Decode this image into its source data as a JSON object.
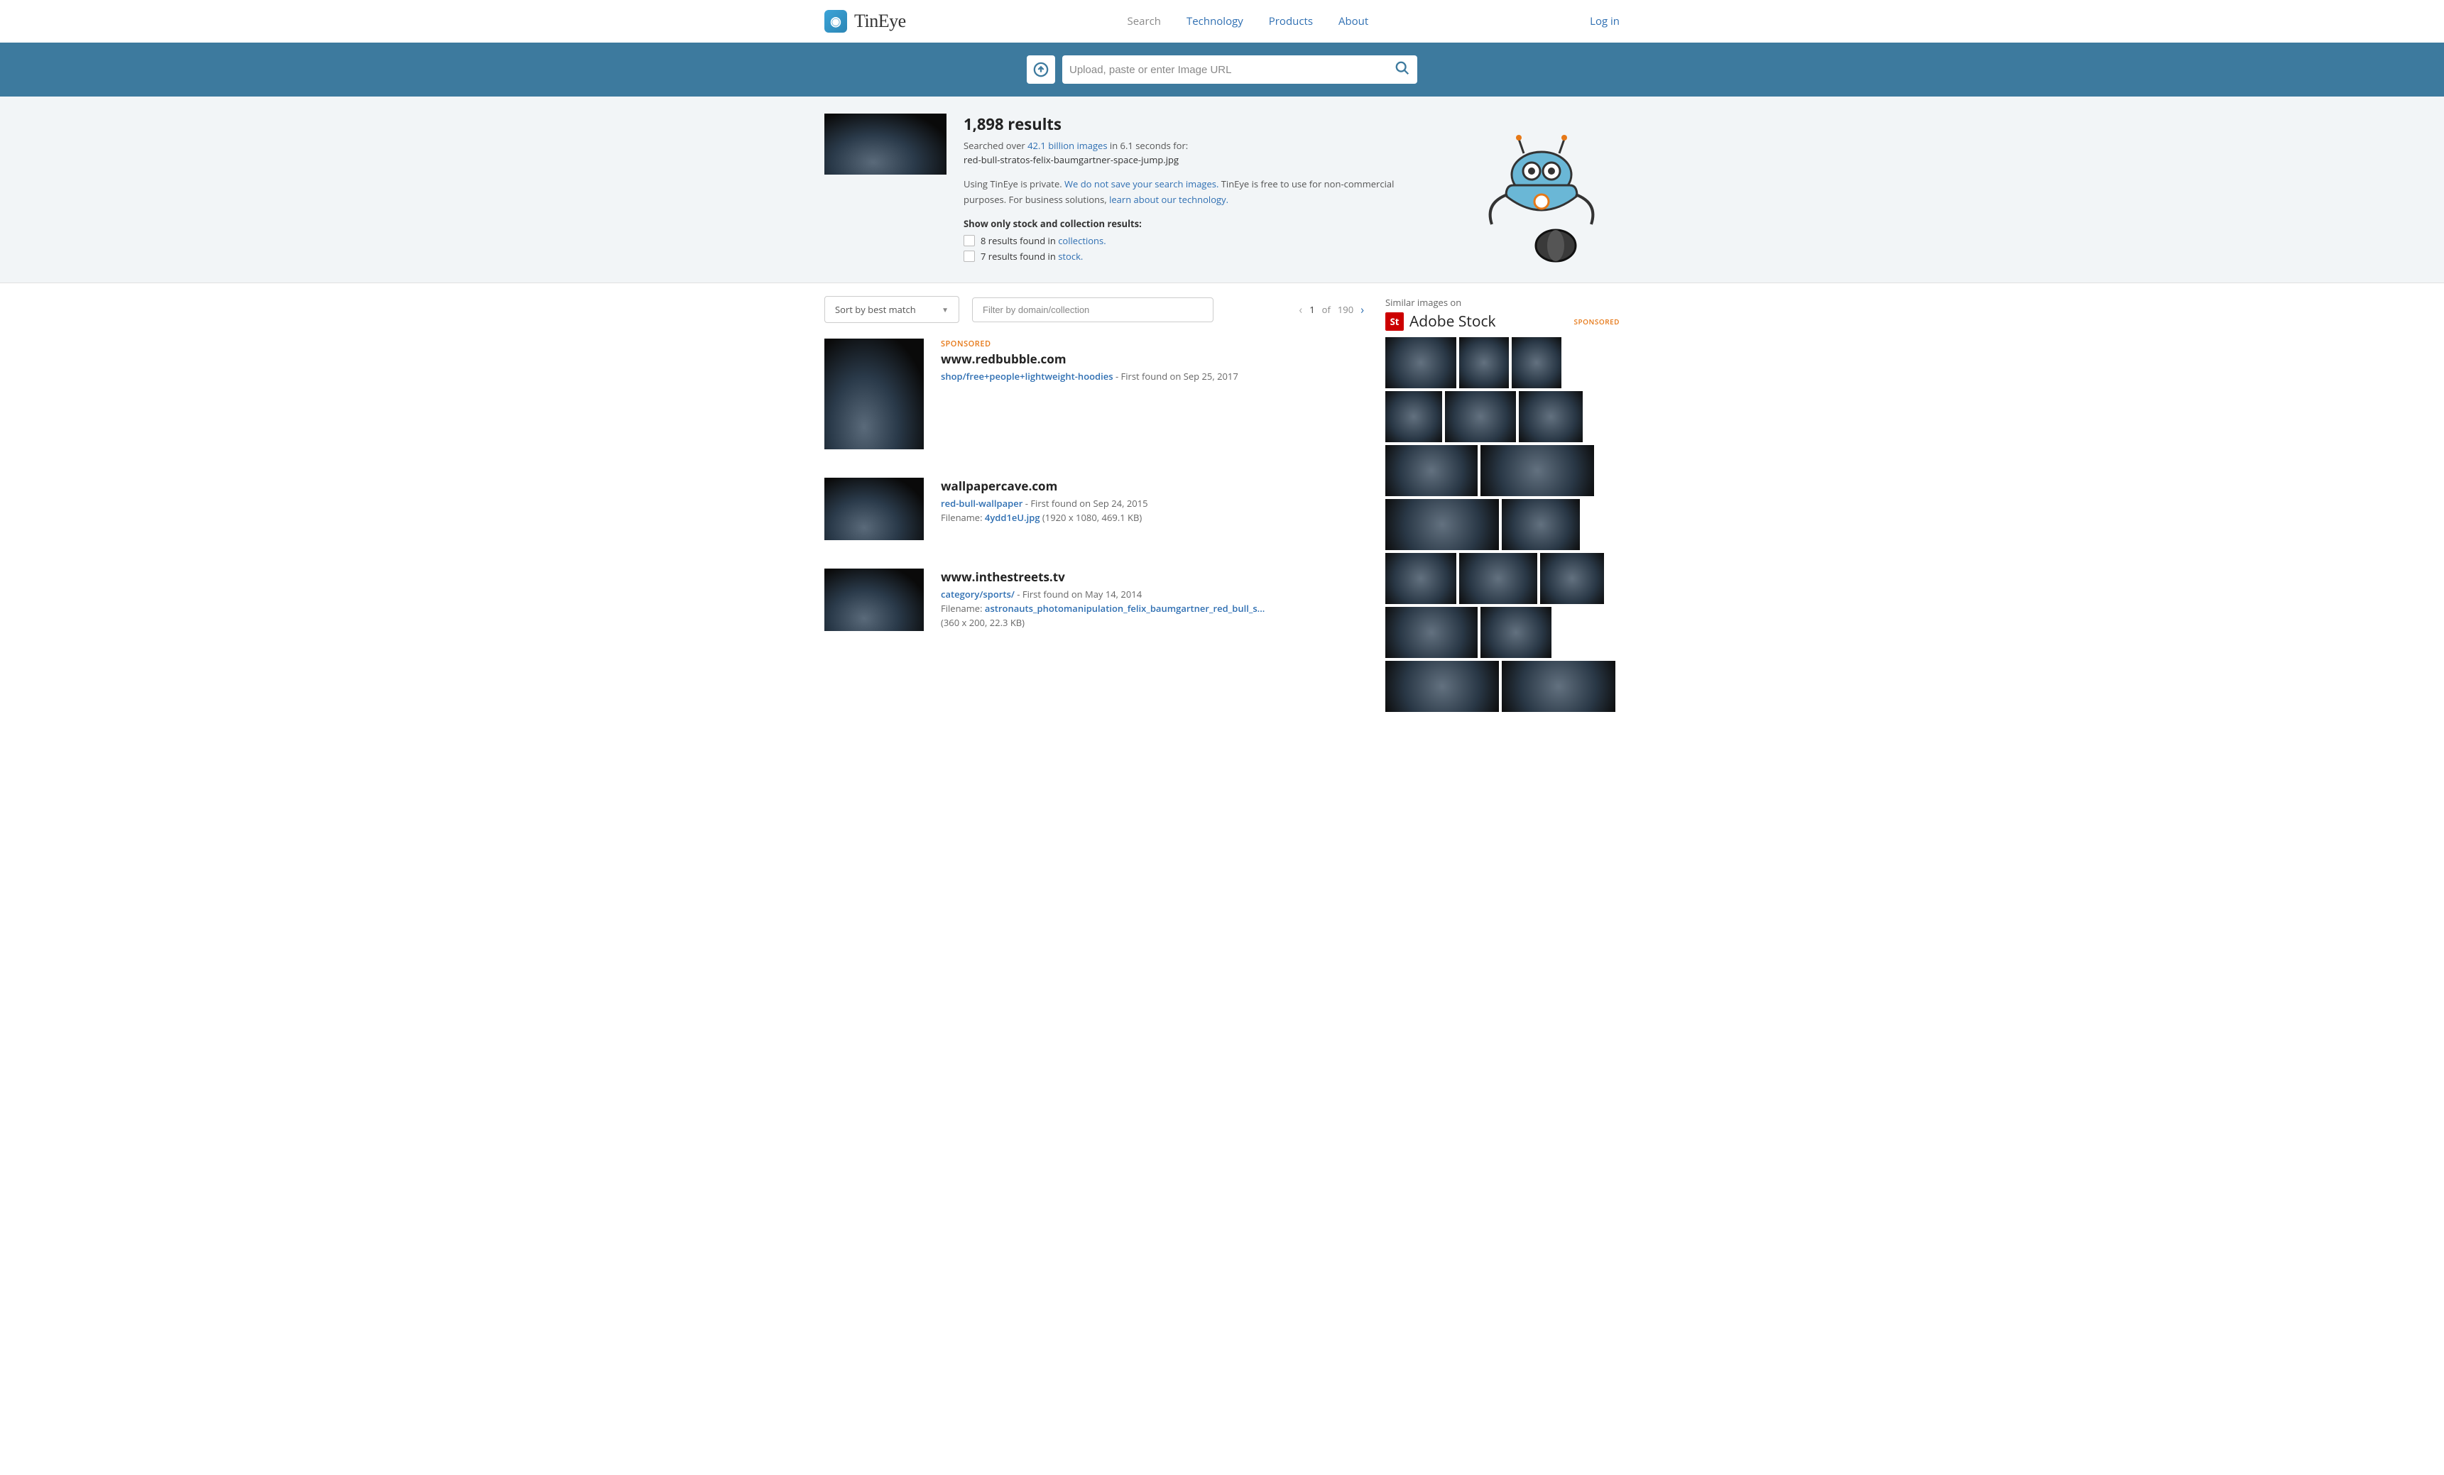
{
  "brand": {
    "name": "TinEye"
  },
  "nav": {
    "search": "Search",
    "technology": "Technology",
    "products": "Products",
    "about": "About",
    "login": "Log in"
  },
  "search": {
    "placeholder": "Upload, paste or enter Image URL"
  },
  "summary": {
    "heading": "1,898 results",
    "searched_prefix": "Searched over ",
    "index_size": "42.1 billion images",
    "searched_suffix": " in 6.1 seconds for:",
    "query_filename": "red-bull-stratos-felix-baumgartner-space-jump.jpg",
    "privacy_a": "Using TinEye is private. ",
    "privacy_link1": "We do not save your search images.",
    "privacy_b": " TinEye is free to use for non-commercial purposes. For business solutions, ",
    "privacy_link2": "learn about our technology.",
    "filters_title": "Show only stock and collection results:",
    "filter_collections_a": "8 results found in ",
    "filter_collections_link": "collections.",
    "filter_stock_a": "7 results found in ",
    "filter_stock_link": "stock."
  },
  "controls": {
    "sort_label": "Sort by best match",
    "filter_placeholder": "Filter by domain/collection",
    "page_current": "1",
    "page_of": "of",
    "page_total": "190"
  },
  "results": [
    {
      "sponsored": true,
      "sponsored_label": "SPONSORED",
      "domain": "www.redbubble.com",
      "path": "shop/free+people+lightweight-hoodies",
      "found": " - First found on Sep 25, 2017",
      "thumb_class": "tall"
    },
    {
      "sponsored": false,
      "domain": "wallpapercave.com",
      "path": "red-bull-wallpaper",
      "found": " - First found on Sep 24, 2015",
      "filename_label": "Filename: ",
      "filename": "4ydd1eU.jpg",
      "dims": " (1920 x 1080, 469.1 KB)",
      "thumb_class": "wide"
    },
    {
      "sponsored": false,
      "domain": "www.inthestreets.tv",
      "path": "category/sports/",
      "found": " - First found on May 14, 2014",
      "filename_label": "Filename: ",
      "filename": "astronauts_photomanipulation_felix_baumgartner_red_bull_s...",
      "dims": "(360 x 200, 22.3 KB)",
      "thumb_class": "wide"
    }
  ],
  "sidebar": {
    "similar_label": "Similar images on",
    "adobe_badge": "St",
    "adobe_text": "Adobe Stock",
    "sponsored": "SPONSORED",
    "thumb_widths": [
      100,
      70,
      70,
      80,
      100,
      90,
      130,
      160,
      160,
      110,
      100,
      110,
      90,
      130,
      100,
      160,
      160
    ]
  }
}
